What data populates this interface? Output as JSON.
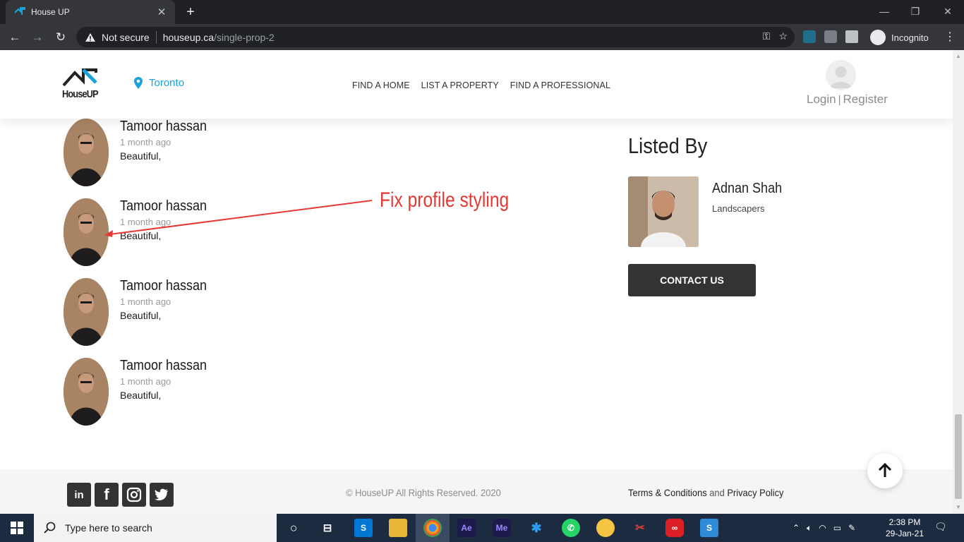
{
  "browser": {
    "tab_title": "House UP",
    "address_warning": "Not secure",
    "url_host": "houseup.ca",
    "url_path": "/single-prop-2",
    "profile_label": "Incognito"
  },
  "site": {
    "logo_text": "HouseUP",
    "location": "Toronto",
    "nav": [
      "FIND A HOME",
      "LIST A PROPERTY",
      "FIND A PROFESSIONAL"
    ],
    "login": "Login",
    "auth_sep": "|",
    "register": "Register"
  },
  "reviews": [
    {
      "name": "Tamoor hassan",
      "time": "1 month ago",
      "text": "Beautiful,"
    },
    {
      "name": "Tamoor hassan",
      "time": "1 month ago",
      "text": "Beautiful,"
    },
    {
      "name": "Tamoor hassan",
      "time": "1 month ago",
      "text": "Beautiful,"
    },
    {
      "name": "Tamoor hassan",
      "time": "1 month ago",
      "text": "Beautiful,"
    }
  ],
  "annotation": {
    "text": "Fix profile styling",
    "color": "#e53935"
  },
  "listed_by": {
    "title": "Listed By",
    "agent_name": "Adnan Shah",
    "agent_role": "Landscapers",
    "contact_label": "CONTACT US"
  },
  "footer": {
    "copyright": "© HouseUP All Rights Reserved. 2020",
    "terms": "Terms & Conditions",
    "and": "and",
    "privacy": "Privacy Policy",
    "socials": [
      "linkedin-icon",
      "facebook-icon",
      "instagram-icon",
      "twitter-icon"
    ]
  },
  "taskbar": {
    "search_placeholder": "Type here to search",
    "time": "2:38 PM",
    "date": "29-Jan-21"
  },
  "colors": {
    "brand_blue": "#1aa3d9",
    "button_dark": "#333333"
  }
}
